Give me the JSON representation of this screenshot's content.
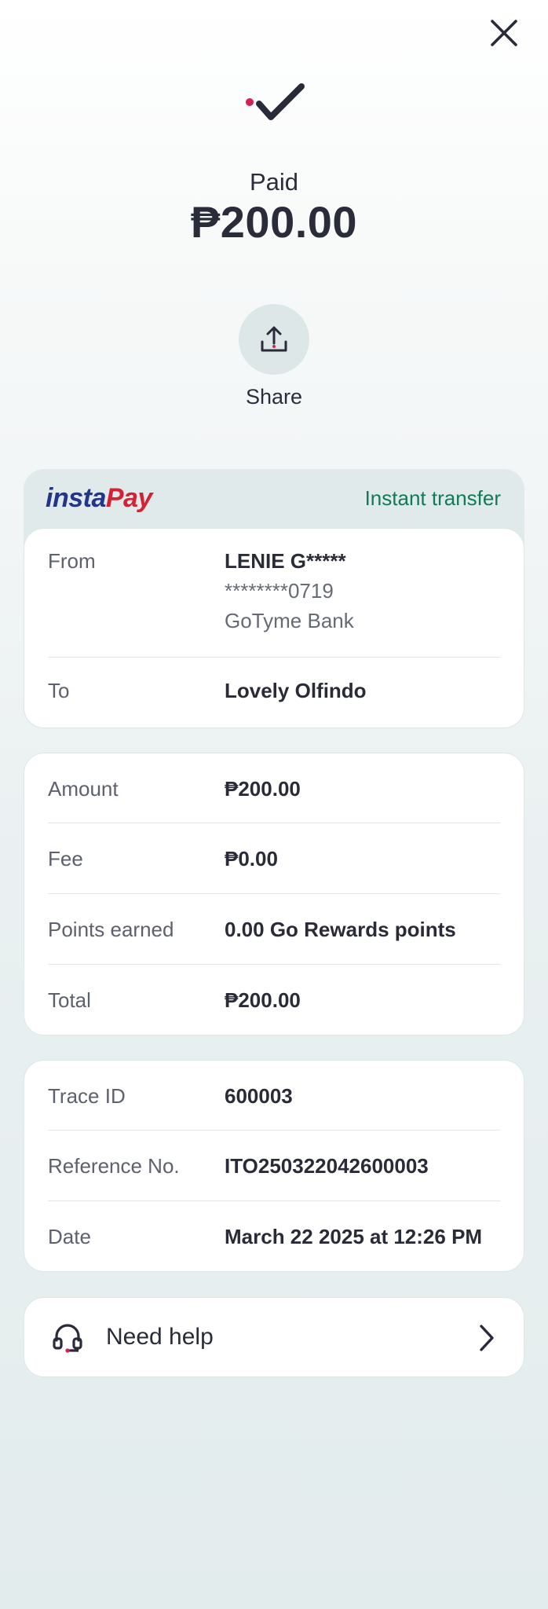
{
  "header": {
    "close_icon": "close-icon",
    "status_label": "Paid",
    "amount": "₱200.00"
  },
  "share": {
    "label": "Share",
    "icon": "share-upload-icon"
  },
  "transfer_card": {
    "logo_prefix": "insta",
    "logo_suffix": "Pay",
    "type_label": "Instant transfer",
    "from_label": "From",
    "from_name": "LENIE G*****",
    "from_account": "********0719",
    "from_bank": "GoTyme Bank",
    "to_label": "To",
    "to_name": "Lovely Olfindo"
  },
  "amount_card": {
    "amount_label": "Amount",
    "amount_value": "₱200.00",
    "fee_label": "Fee",
    "fee_value": "₱0.00",
    "points_label": "Points earned",
    "points_value": "0.00 Go Rewards points",
    "total_label": "Total",
    "total_value": "₱200.00"
  },
  "trace_card": {
    "trace_label": "Trace ID",
    "trace_value": "600003",
    "reference_label": "Reference No.",
    "reference_value": "ITO250322042600003",
    "date_label": "Date",
    "date_value": "March 22 2025 at 12:26 PM"
  },
  "help": {
    "label": "Need help",
    "icon": "headset-icon"
  },
  "colors": {
    "accent_red": "#d6204f",
    "text_dark": "#2a2b3a",
    "instant_green": "#127a56",
    "instapay_blue": "#22358a",
    "instapay_red": "#d42234"
  }
}
